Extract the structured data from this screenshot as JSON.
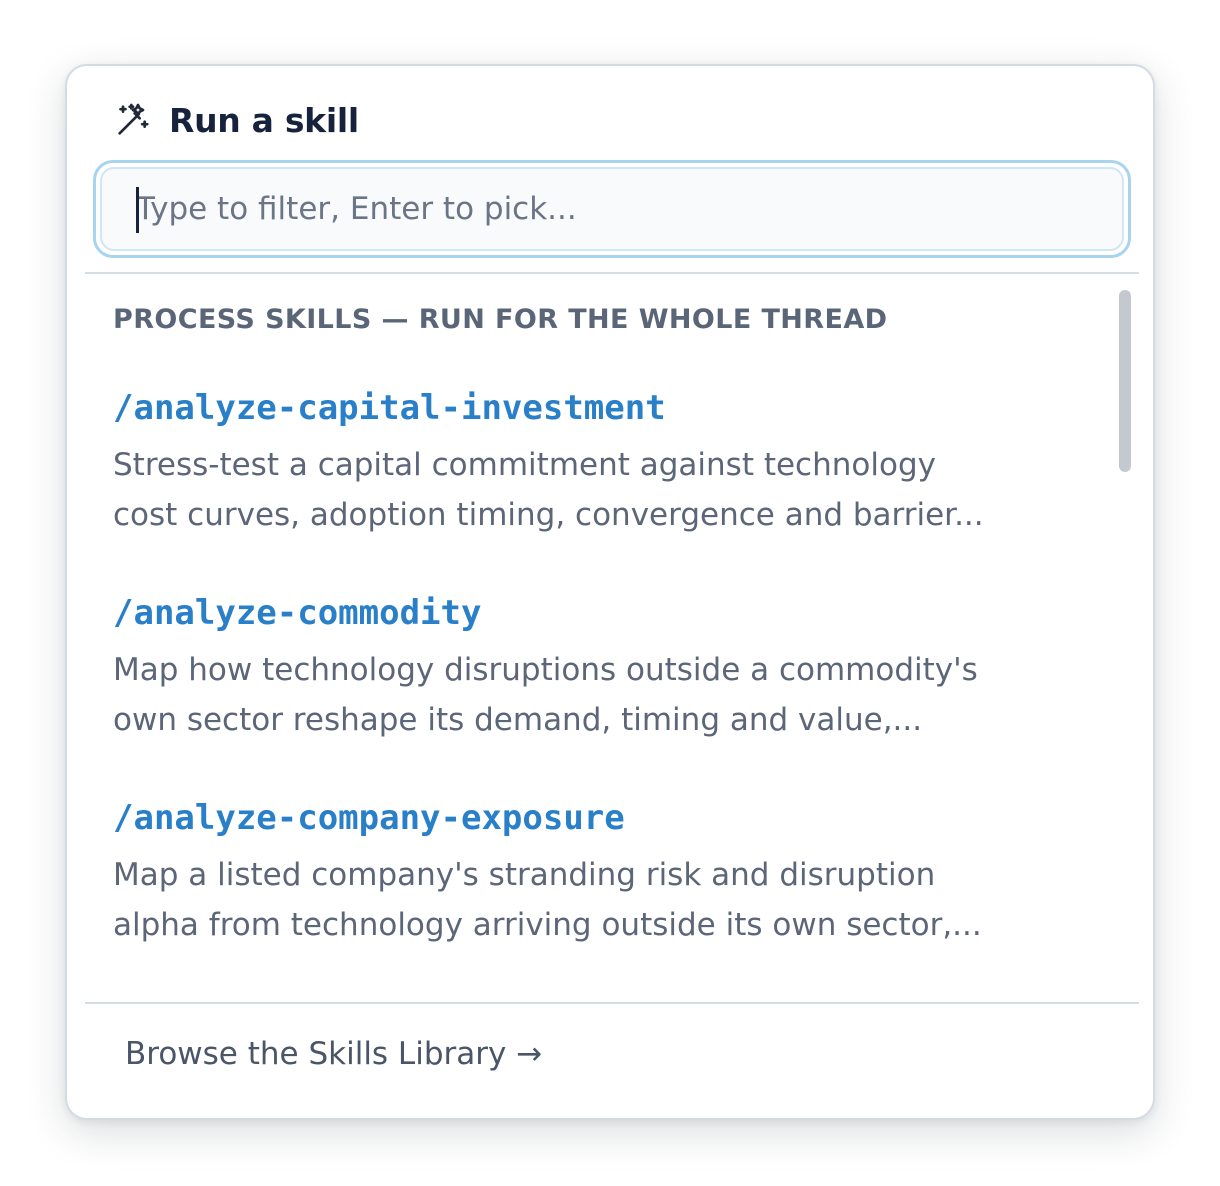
{
  "header": {
    "icon": "magic-wand-icon",
    "title": "Run a skill"
  },
  "search": {
    "value": "",
    "placeholder": "Type to filter, Enter to pick..."
  },
  "section": {
    "title": "PROCESS SKILLS — RUN FOR THE WHOLE THREAD"
  },
  "skills": [
    {
      "name": "/analyze-capital-investment",
      "desc_line1": "Stress-test a capital commitment against technology",
      "desc_line2": "cost curves, adoption timing, convergence and barrier..."
    },
    {
      "name": "/analyze-commodity",
      "desc_line1": "Map how technology disruptions outside a commodity's",
      "desc_line2": "own sector reshape its demand, timing and value,..."
    },
    {
      "name": "/analyze-company-exposure",
      "desc_line1": "Map a listed company's stranding risk and disruption",
      "desc_line2": "alpha from technology arriving outside its own sector,..."
    }
  ],
  "footer": {
    "browse_label": "Browse the Skills Library →"
  },
  "colors": {
    "accent": "#2a7fc9",
    "title": "#17233d",
    "muted": "#5c6678",
    "focus_ring": "#a9d4ef"
  }
}
